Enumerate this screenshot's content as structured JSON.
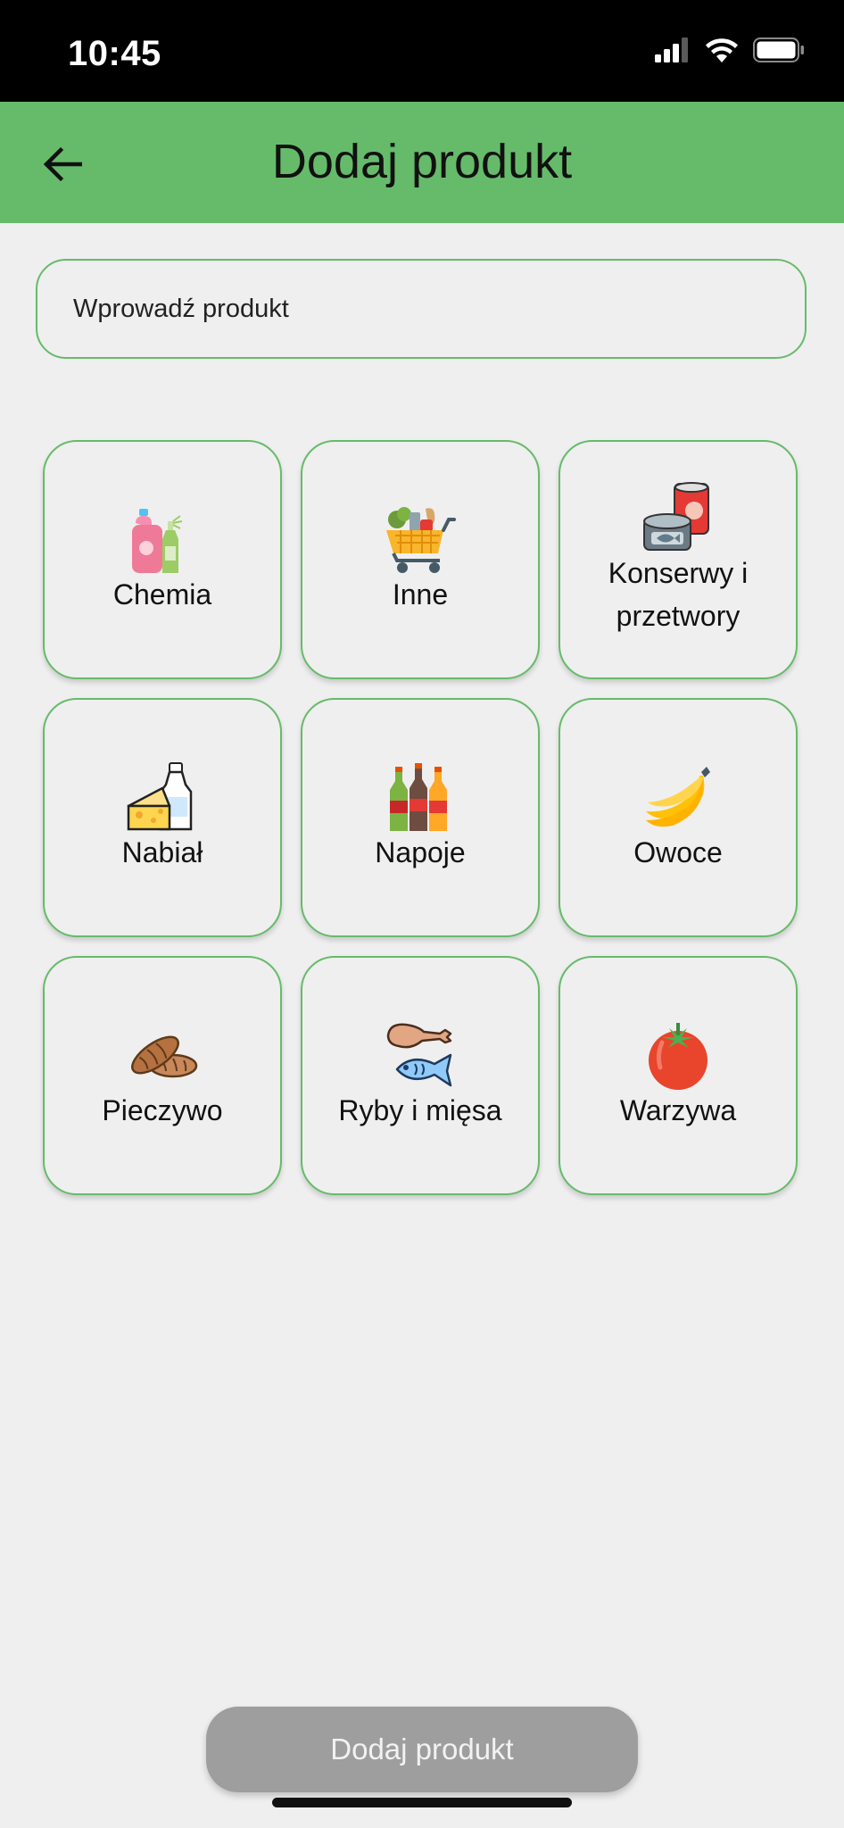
{
  "status_bar": {
    "time": "10:45"
  },
  "header": {
    "title": "Dodaj produkt",
    "back_icon": "arrow-left-icon"
  },
  "search": {
    "placeholder": "Wprowadź produkt",
    "value": ""
  },
  "categories": [
    {
      "label": "Chemia",
      "icon": "cleaning-bottles-icon"
    },
    {
      "label": "Inne",
      "icon": "shopping-cart-icon"
    },
    {
      "label": "Konserwy i przetwory",
      "icon": "canned-food-icon"
    },
    {
      "label": "Nabiał",
      "icon": "cheese-milk-icon"
    },
    {
      "label": "Napoje",
      "icon": "drink-bottles-icon"
    },
    {
      "label": "Owoce",
      "icon": "banana-icon"
    },
    {
      "label": "Pieczywo",
      "icon": "bread-icon"
    },
    {
      "label": "Ryby i mięsa",
      "icon": "drumstick-fish-icon"
    },
    {
      "label": "Warzywa",
      "icon": "tomato-icon"
    }
  ],
  "footer": {
    "add_label": "Dodaj produkt"
  },
  "colors": {
    "accent": "#66bb6a",
    "button_disabled": "#9e9e9e",
    "background": "#efefef"
  }
}
